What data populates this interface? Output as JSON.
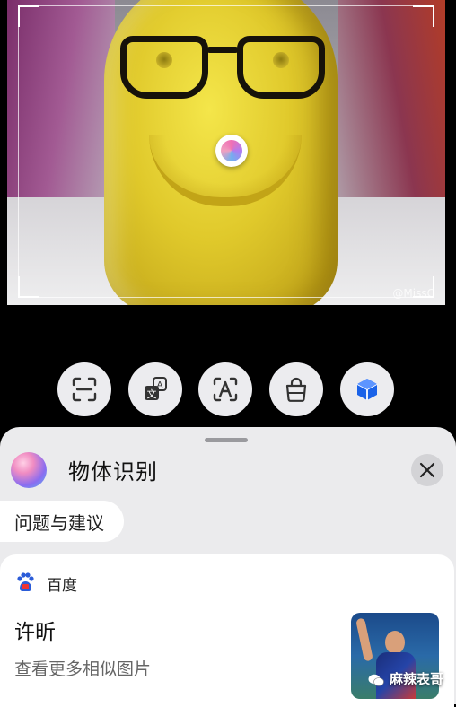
{
  "image_area": {
    "subject": "yellow figure with glasses",
    "watermark_small": "@MissC"
  },
  "tools": [
    {
      "icon": "scan-icon"
    },
    {
      "icon": "translate-icon"
    },
    {
      "icon": "text-recognize-icon"
    },
    {
      "icon": "shopping-bag-icon"
    },
    {
      "icon": "object-cube-icon",
      "active": true
    }
  ],
  "sheet": {
    "title": "物体识别",
    "feedback_label": "问题与建议",
    "card": {
      "source": "百度",
      "result_name": "许昕",
      "more_link": "查看更多相似图片"
    }
  },
  "brand_watermark": "麻辣表哥",
  "colors": {
    "accent_blue": "#1a62e8",
    "sheet_bg": "#ebebed",
    "tool_bg": "#ececef"
  }
}
